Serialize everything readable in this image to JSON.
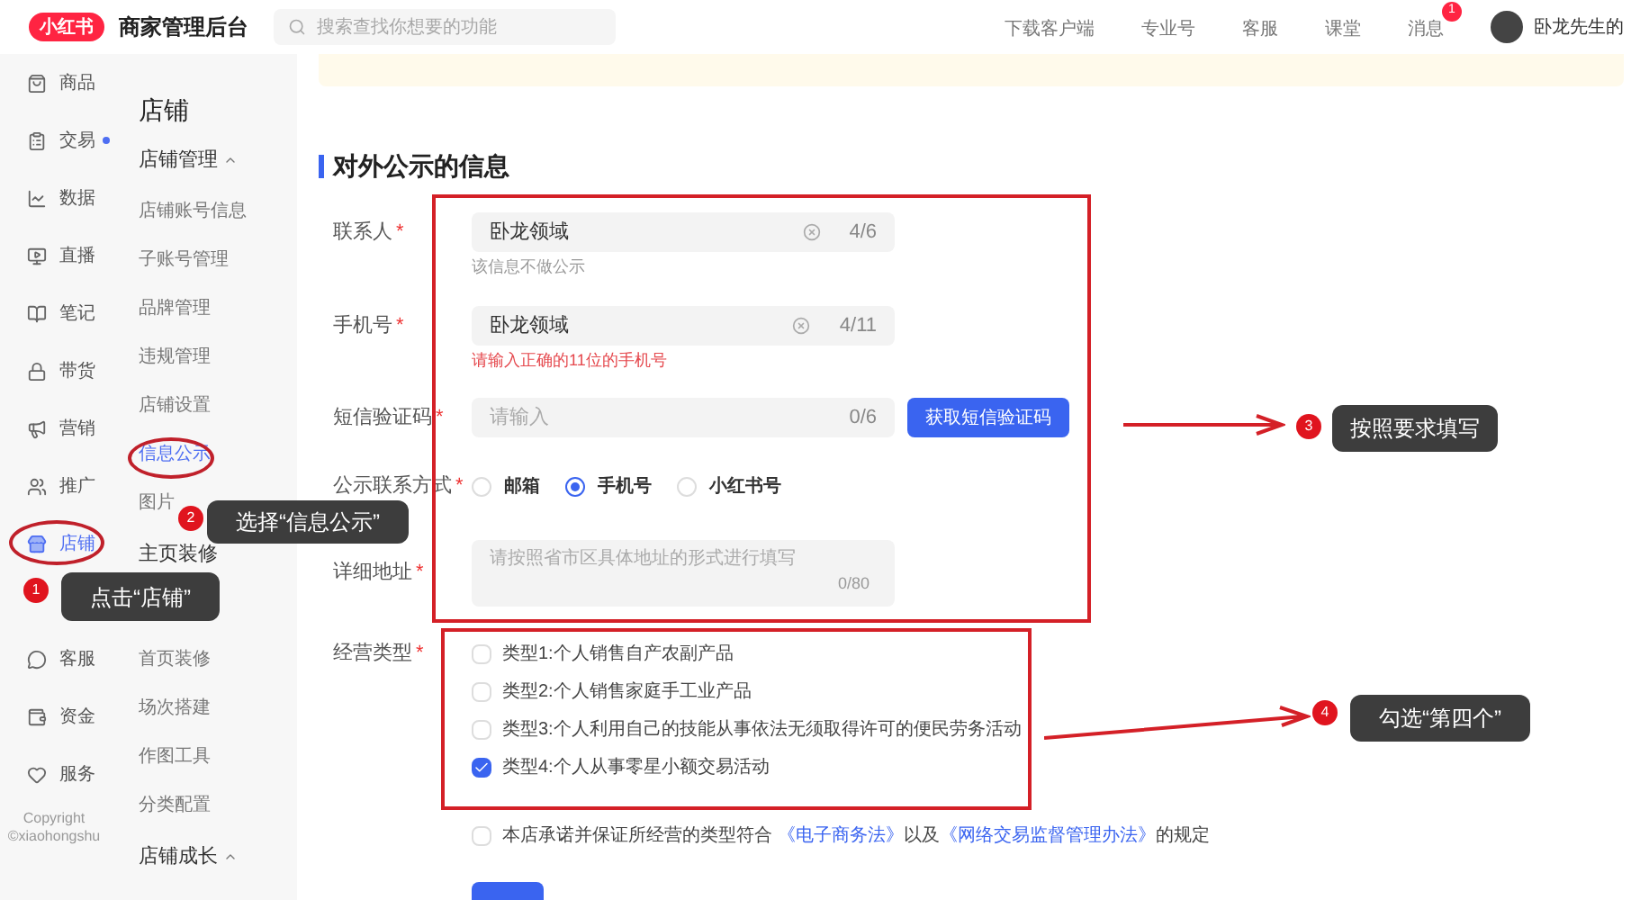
{
  "topbar": {
    "logo": "小红书",
    "title": "商家管理后台",
    "search": {
      "placeholder": "搜索查找你想要的功能"
    },
    "links": [
      {
        "label": "下载客户端"
      },
      {
        "label": "专业号"
      },
      {
        "label": "客服"
      },
      {
        "label": "课堂"
      },
      {
        "label": "消息",
        "badge": "1"
      }
    ],
    "user": "卧龙先生的"
  },
  "rail": {
    "items": [
      {
        "kind": "item",
        "label": "商品",
        "selected": false,
        "dot": false
      },
      {
        "kind": "item",
        "label": "交易",
        "selected": false,
        "dot": true
      },
      {
        "kind": "item",
        "label": "数据",
        "selected": false,
        "dot": false
      },
      {
        "kind": "item",
        "label": "直播",
        "selected": false,
        "dot": false
      },
      {
        "kind": "item",
        "label": "笔记",
        "selected": false,
        "dot": false
      },
      {
        "kind": "item",
        "label": "带货",
        "selected": false,
        "dot": false
      },
      {
        "kind": "item",
        "label": "营销",
        "selected": false,
        "dot": false
      },
      {
        "kind": "item",
        "label": "推广",
        "selected": false,
        "dot": false
      },
      {
        "kind": "item",
        "label": "店铺",
        "selected": true,
        "dot": false
      },
      {
        "kind": "hidden"
      },
      {
        "kind": "item",
        "label": "客服",
        "selected": false,
        "dot": false
      },
      {
        "kind": "item",
        "label": "资金",
        "selected": false,
        "dot": false
      },
      {
        "kind": "item",
        "label": "服务",
        "selected": false,
        "dot": false
      }
    ],
    "copyright": [
      "Copyright",
      "©xiaohongshu"
    ]
  },
  "submenu": {
    "title": "店铺",
    "items": [
      {
        "kind": "group",
        "label": "店铺管理",
        "caret": true,
        "selected": false
      },
      {
        "kind": "item",
        "label": "店铺账号信息",
        "selected": false
      },
      {
        "kind": "item",
        "label": "子账号管理",
        "selected": false
      },
      {
        "kind": "item",
        "label": "品牌管理",
        "selected": false
      },
      {
        "kind": "item",
        "label": "违规管理",
        "selected": false
      },
      {
        "kind": "item",
        "label": "店铺设置",
        "selected": false
      },
      {
        "kind": "item",
        "label": "信息公示",
        "selected": true
      },
      {
        "kind": "item",
        "label": "图片",
        "selected": false
      },
      {
        "kind": "group",
        "label": "主页装修",
        "caret": false,
        "selected": false
      },
      {
        "kind": "hidden"
      },
      {
        "kind": "item",
        "label": "首页装修",
        "selected": false
      },
      {
        "kind": "item",
        "label": "场次搭建",
        "selected": false
      },
      {
        "kind": "item",
        "label": "作图工具",
        "selected": false
      },
      {
        "kind": "item",
        "label": "分类配置",
        "selected": false
      },
      {
        "kind": "group",
        "label": "店铺成长",
        "caret": true,
        "selected": false
      }
    ]
  },
  "section_title": "对外公示的信息",
  "form": {
    "contact": {
      "required_mark": "*",
      "label": "联系人",
      "value": "卧龙领域",
      "count": "4/6",
      "help": "该信息不做公示"
    },
    "phone": {
      "required_mark": "*",
      "label": "手机号",
      "value": "卧龙领域",
      "count": "4/11",
      "error": "请输入正确的11位的手机号"
    },
    "sms": {
      "required_mark": "*",
      "label": "短信验证码",
      "placeholder": "请输入",
      "count": "0/6",
      "button": "获取短信验证码"
    },
    "method": {
      "required_mark": "*",
      "label": "公示联系方式",
      "options": [
        {
          "label": "邮箱",
          "selected": false
        },
        {
          "label": "手机号",
          "selected": true
        },
        {
          "label": "小红书号",
          "selected": false
        }
      ]
    },
    "address": {
      "required_mark": "*",
      "label": "详细地址",
      "placeholder": "请按照省市区具体地址的形式进行填写",
      "count": "0/80"
    },
    "types": {
      "required_mark": "*",
      "label": "经营类型",
      "options": [
        {
          "label": "类型1:个人销售自产农副产品",
          "checked": false
        },
        {
          "label": "类型2:个人销售家庭手工业产品",
          "checked": false
        },
        {
          "label": "类型3:个人利用自己的技能从事依法无须取得许可的便民劳务活动",
          "checked": false
        },
        {
          "label": "类型4:个人从事零星小额交易活动",
          "checked": true
        }
      ]
    },
    "agreement": {
      "checked": false,
      "text": "本店承诺并保证所经营的类型符合",
      "link1": "《电子商务法》",
      "middle": "以及",
      "link2": "《网络交易监督管理办法》",
      "end": "的规定"
    }
  },
  "annotations": [
    {
      "number": "1",
      "text": "点击“店铺”"
    },
    {
      "number": "2",
      "text": "选择“信息公示”"
    },
    {
      "number": "3",
      "text": "按照要求填写"
    },
    {
      "number": "4",
      "text": "勾选“第四个”"
    }
  ]
}
